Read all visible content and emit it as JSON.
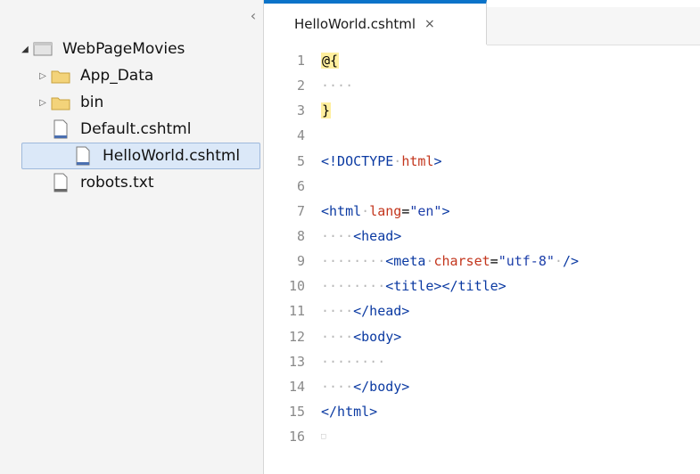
{
  "sidebar": {
    "collapse_glyph": "‹",
    "root": {
      "label": "WebPageMovies",
      "icon": "project-icon"
    },
    "items": [
      {
        "label": "App_Data",
        "icon": "folder-icon",
        "expandable": true
      },
      {
        "label": "bin",
        "icon": "folder-icon",
        "expandable": true
      },
      {
        "label": "Default.cshtml",
        "icon": "file-icon",
        "expandable": false
      },
      {
        "label": "HelloWorld.cshtml",
        "icon": "file-icon",
        "expandable": false,
        "selected": true
      },
      {
        "label": "robots.txt",
        "icon": "file-icon",
        "expandable": false
      }
    ]
  },
  "editor": {
    "tab": {
      "title": "HelloWorld.cshtml",
      "close": "×"
    },
    "lines": [
      {
        "num": "1"
      },
      {
        "num": "2"
      },
      {
        "num": "3"
      },
      {
        "num": "4"
      },
      {
        "num": "5"
      },
      {
        "num": "6"
      },
      {
        "num": "7"
      },
      {
        "num": "8"
      },
      {
        "num": "9"
      },
      {
        "num": "10"
      },
      {
        "num": "11"
      },
      {
        "num": "12"
      },
      {
        "num": "13"
      },
      {
        "num": "14"
      },
      {
        "num": "15"
      },
      {
        "num": "16"
      }
    ],
    "code": {
      "l1": "@{",
      "l3": "}",
      "l5_open": "<!DOCTYPE",
      "l5_name": "html",
      "l5_close": ">",
      "l7_open": "<html",
      "l7_attr": "lang",
      "l7_eq": "=",
      "l7_val": "\"en\"",
      "l7_close": ">",
      "l8": "<head>",
      "l9_open": "<meta",
      "l9_attr": "charset",
      "l9_eq": "=",
      "l9_val": "\"utf-8\"",
      "l9_close": "/>",
      "l10_a": "<title>",
      "l10_b": "</title>",
      "l11": "</head>",
      "l12": "<body>",
      "l14": "</body>",
      "l15": "</html>"
    }
  },
  "colors": {
    "tab_accent": "#0a73c9",
    "selection_bg": "#dbe8f8",
    "razor_highlight": "#ffef9e",
    "tag": "#0b3aa2",
    "attr": "#c3361d",
    "value": "#1c3ea9"
  }
}
